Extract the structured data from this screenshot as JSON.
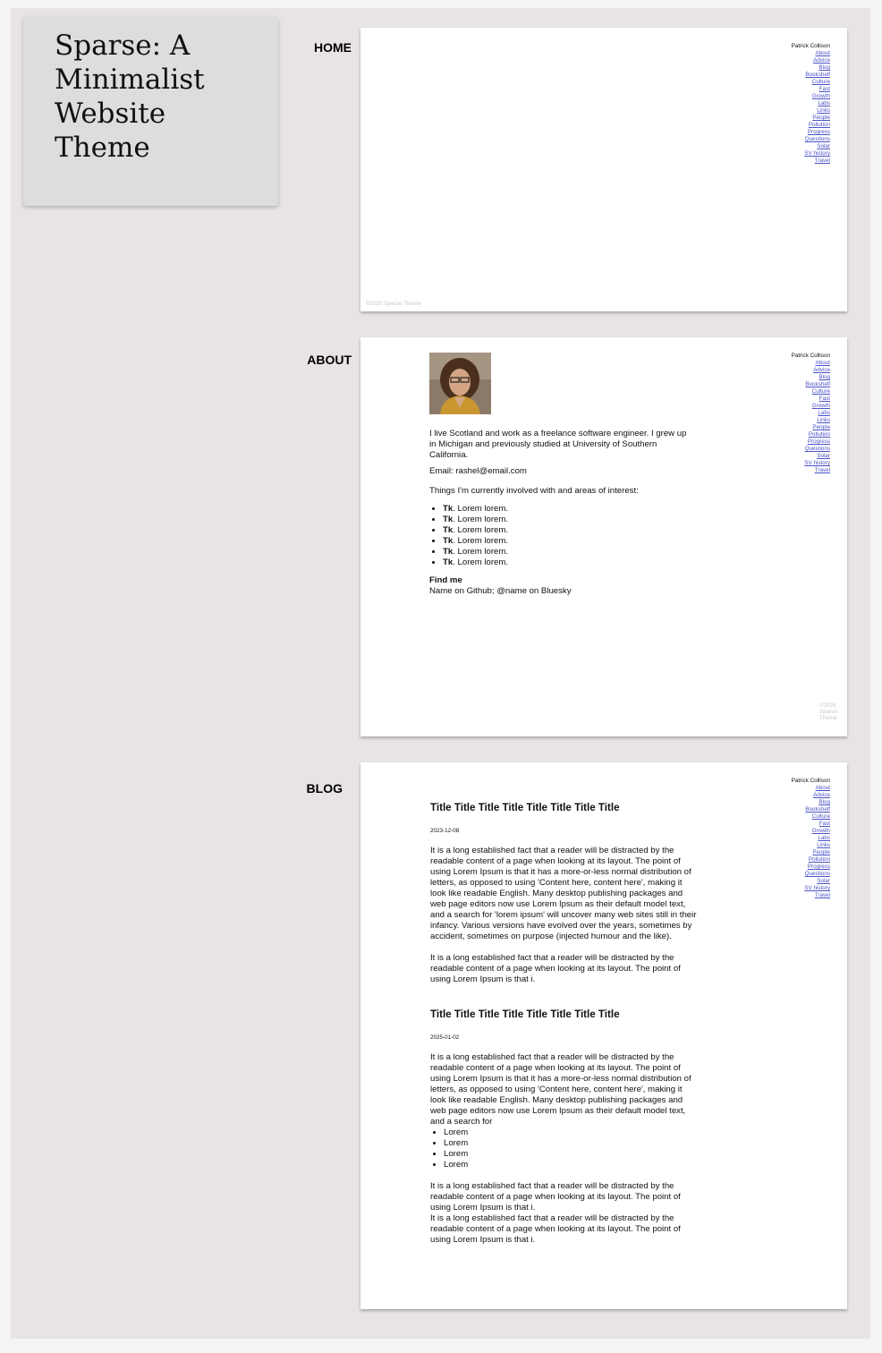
{
  "page_title": "Sparse: A Minimalist Website Theme",
  "sections": {
    "home": "HOME",
    "about": "ABOUT",
    "blog": "BLOG"
  },
  "nav": {
    "author": "Patrick Collison",
    "links": [
      "About",
      "Advice",
      "Blog",
      "Bookshelf",
      "Culture",
      "Fast",
      "Growth",
      "Labs",
      "Links",
      "People",
      "Pollution",
      "Progress",
      "Questions",
      "Solar",
      "SV history",
      "Travel"
    ]
  },
  "footer": "©2025 Sparse Theme",
  "about": {
    "bio": "I live Scotland and work as a freelance software engineer. I grew up in Michigan and previously studied at University of Southern California.",
    "email": "Email: rashel@email.com",
    "interests_intro": "Things I'm currently involved with and areas of interest:",
    "interests": [
      {
        "bold": "Tk",
        "text": ".  Lorem lorem."
      },
      {
        "bold": "Tk",
        "text": ".  Lorem lorem."
      },
      {
        "bold": "Tk",
        "text": ".  Lorem lorem."
      },
      {
        "bold": "Tk",
        "text": ".  Lorem lorem."
      },
      {
        "bold": "Tk",
        "text": ".  Lorem lorem."
      },
      {
        "bold": "Tk",
        "text": ".  Lorem lorem."
      }
    ],
    "find_me_heading": "Find me",
    "find_me_text": "Name on Github; @name on Bluesky"
  },
  "blog": {
    "posts": [
      {
        "title": "Title Title Title Title Title Title Title Title",
        "date": "2023-12-08",
        "para1": "It is a long established fact that a reader will be distracted by the readable content of a page when looking at its layout. The point of using Lorem Ipsum is that it has a more-or-less normal distribution of letters, as opposed to using 'Content here, content here', making it look like readable English. Many desktop publishing packages and web page editors now use Lorem Ipsum as their default model text, and a search for 'lorem ipsum' will uncover many web sites still in their infancy. Various versions have evolved over the years, sometimes by accident, sometimes on purpose (injected humour and the like).",
        "para2": "It is a long established fact that a reader will be distracted by the readable content of a page when looking at its layout. The point of using Lorem Ipsum is that i."
      },
      {
        "title": "Title Title Title Title Title Title Title Title",
        "date": "2025-01-02",
        "para1": "It is a long established fact that a reader will be distracted by the readable content of a page when looking at its layout. The point of using Lorem Ipsum is that it has a more-or-less normal distribution of letters, as opposed to using 'Content here, content here', making it look like readable English. Many desktop publishing packages and web page editors now use Lorem Ipsum as their default model text, and a search for",
        "list": [
          "Lorem",
          "Lorem",
          "Lorem",
          "Lorem"
        ],
        "para2": "It is a long established fact that a reader will be distracted by the readable content of a page when looking at its layout. The point of using Lorem Ipsum is that i.",
        "para3": "It is a long established fact that a reader will be distracted by the readable content of a page when looking at its layout. The point of using Lorem Ipsum is that i."
      }
    ]
  }
}
